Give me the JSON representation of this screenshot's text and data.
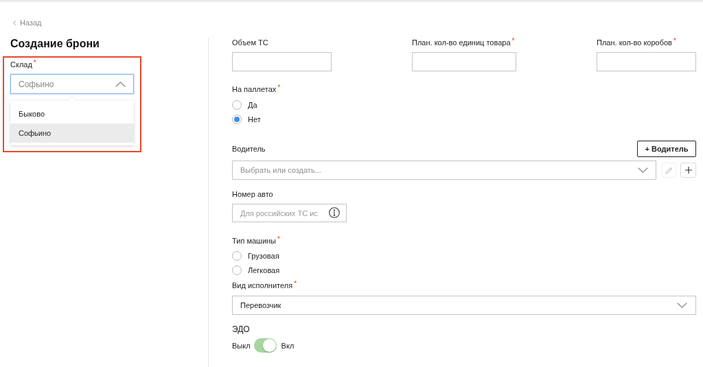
{
  "back_link": {
    "label": "Назад"
  },
  "title": "Создание брони",
  "warehouse": {
    "label": "Склад",
    "required_mark": "*",
    "value": "Софьино",
    "expanded": true,
    "options": [
      {
        "label": "Быково",
        "selected": false
      },
      {
        "label": "Софьино",
        "selected": true
      }
    ]
  },
  "quantities": [
    {
      "label": "Объем ТС"
    },
    {
      "label": "План. кол-во единиц товара",
      "required_mark": "*"
    },
    {
      "label": "План. кол-во коробов",
      "required_mark": "*"
    }
  ],
  "on_pallets": {
    "label": "На паллетах",
    "required_mark": "*",
    "options": [
      {
        "label": "Да",
        "selected": false
      },
      {
        "label": "Нет",
        "selected": true
      }
    ]
  },
  "driver": {
    "label": "Водитель",
    "add_button": "+ Водитель",
    "placeholder": "Выбрать или создать...",
    "edit_disabled": true
  },
  "car_number": {
    "label": "Номер авто",
    "placeholder": "Для российских ТС ис"
  },
  "vehicle_type": {
    "label": "Тип машины",
    "required_mark": "*",
    "options": [
      {
        "label": "Грузовая",
        "selected": false
      },
      {
        "label": "Легковая",
        "selected": false
      }
    ]
  },
  "performer_type": {
    "label": "Вид исполнителя",
    "required_mark": "*",
    "value": "Перевозчик"
  },
  "edo": {
    "label": "ЭДО",
    "off_label": "Выкл",
    "on_label": "Вкл",
    "on": true
  }
}
